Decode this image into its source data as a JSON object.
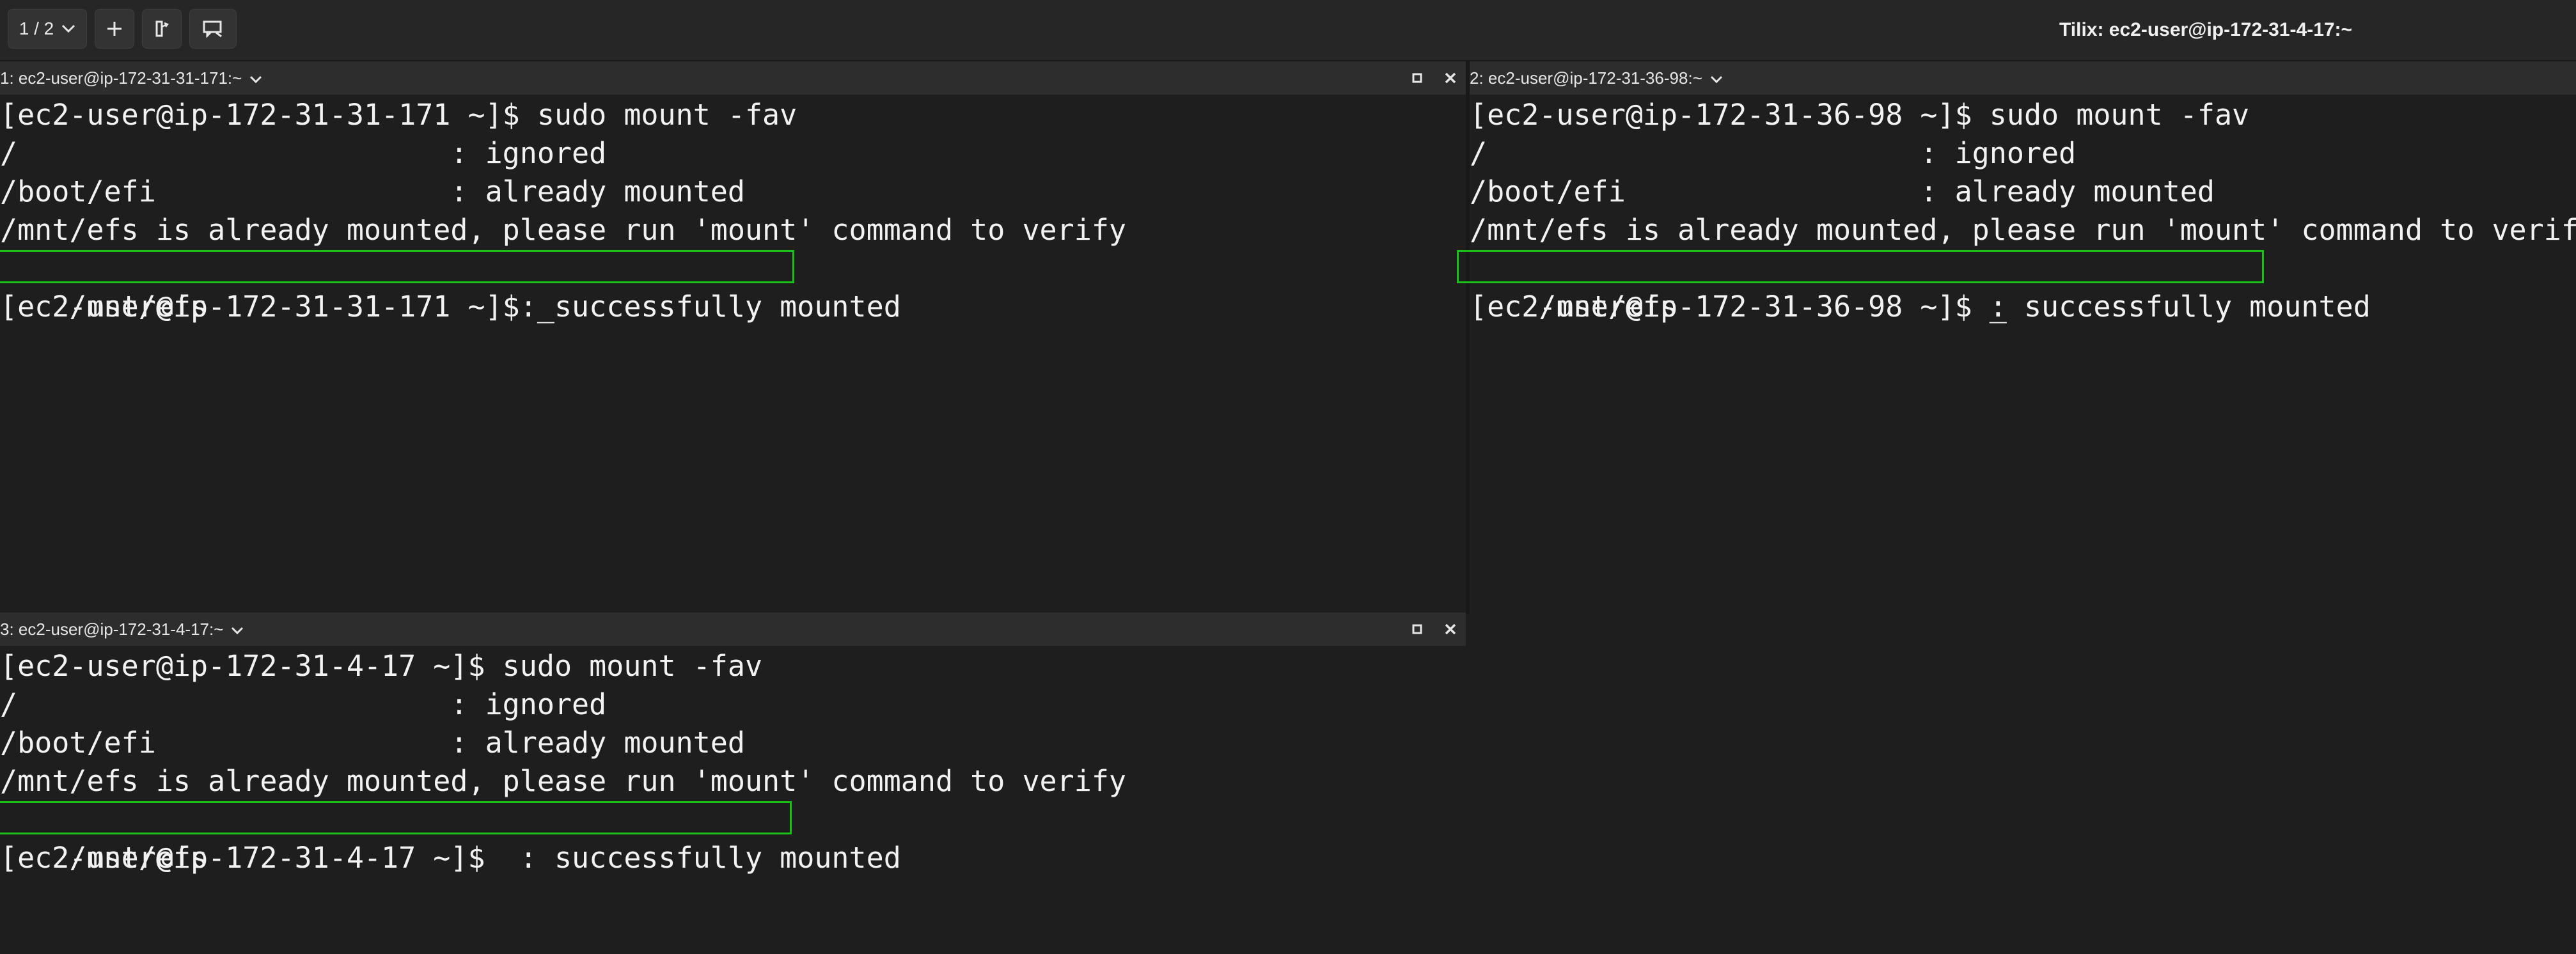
{
  "toolbar": {
    "session_switcher_label": "1 / 2",
    "add_icon": "plus-icon",
    "sync_icon": "sync-input-icon",
    "notify_icon": "notification-icon"
  },
  "window": {
    "title": "Tilix: ec2-user@ip-172-31-4-17:~"
  },
  "panes": [
    {
      "header": "1: ec2-user@ip-172-31-31-171:~",
      "lines": [
        "[ec2-user@ip-172-31-31-171 ~]$ sudo mount -fav",
        "/                         : ignored",
        "/boot/efi                 : already mounted",
        "/mnt/efs is already mounted, please run 'mount' command to verify",
        "/mnt/efs                  : successfully mounted",
        "[ec2-user@ip-172-31-31-171 ~]$ _"
      ],
      "highlighted_line": 4
    },
    {
      "header": "2: ec2-user@ip-172-31-36-98:~",
      "lines": [
        "[ec2-user@ip-172-31-36-98 ~]$ sudo mount -fav",
        "/                         : ignored",
        "/boot/efi                 : already mounted",
        "/mnt/efs is already mounted, please run 'mount' command to verify",
        "/mnt/efs                  : successfully mounted",
        "[ec2-user@ip-172-31-36-98 ~]$ _"
      ],
      "highlighted_line": 4
    },
    {
      "header": "3: ec2-user@ip-172-31-4-17:~",
      "lines": [
        "[ec2-user@ip-172-31-4-17 ~]$ sudo mount -fav",
        "/                         : ignored",
        "/boot/efi                 : already mounted",
        "/mnt/efs is already mounted, please run 'mount' command to verify",
        "/mnt/efs                  : successfully mounted",
        "[ec2-user@ip-172-31-4-17 ~]$"
      ],
      "highlighted_line": 4
    }
  ],
  "colors": {
    "highlight_box": "#19c119",
    "terminal_bg": "#1e1e1e",
    "pane_header_bg": "#2d2d2d"
  }
}
